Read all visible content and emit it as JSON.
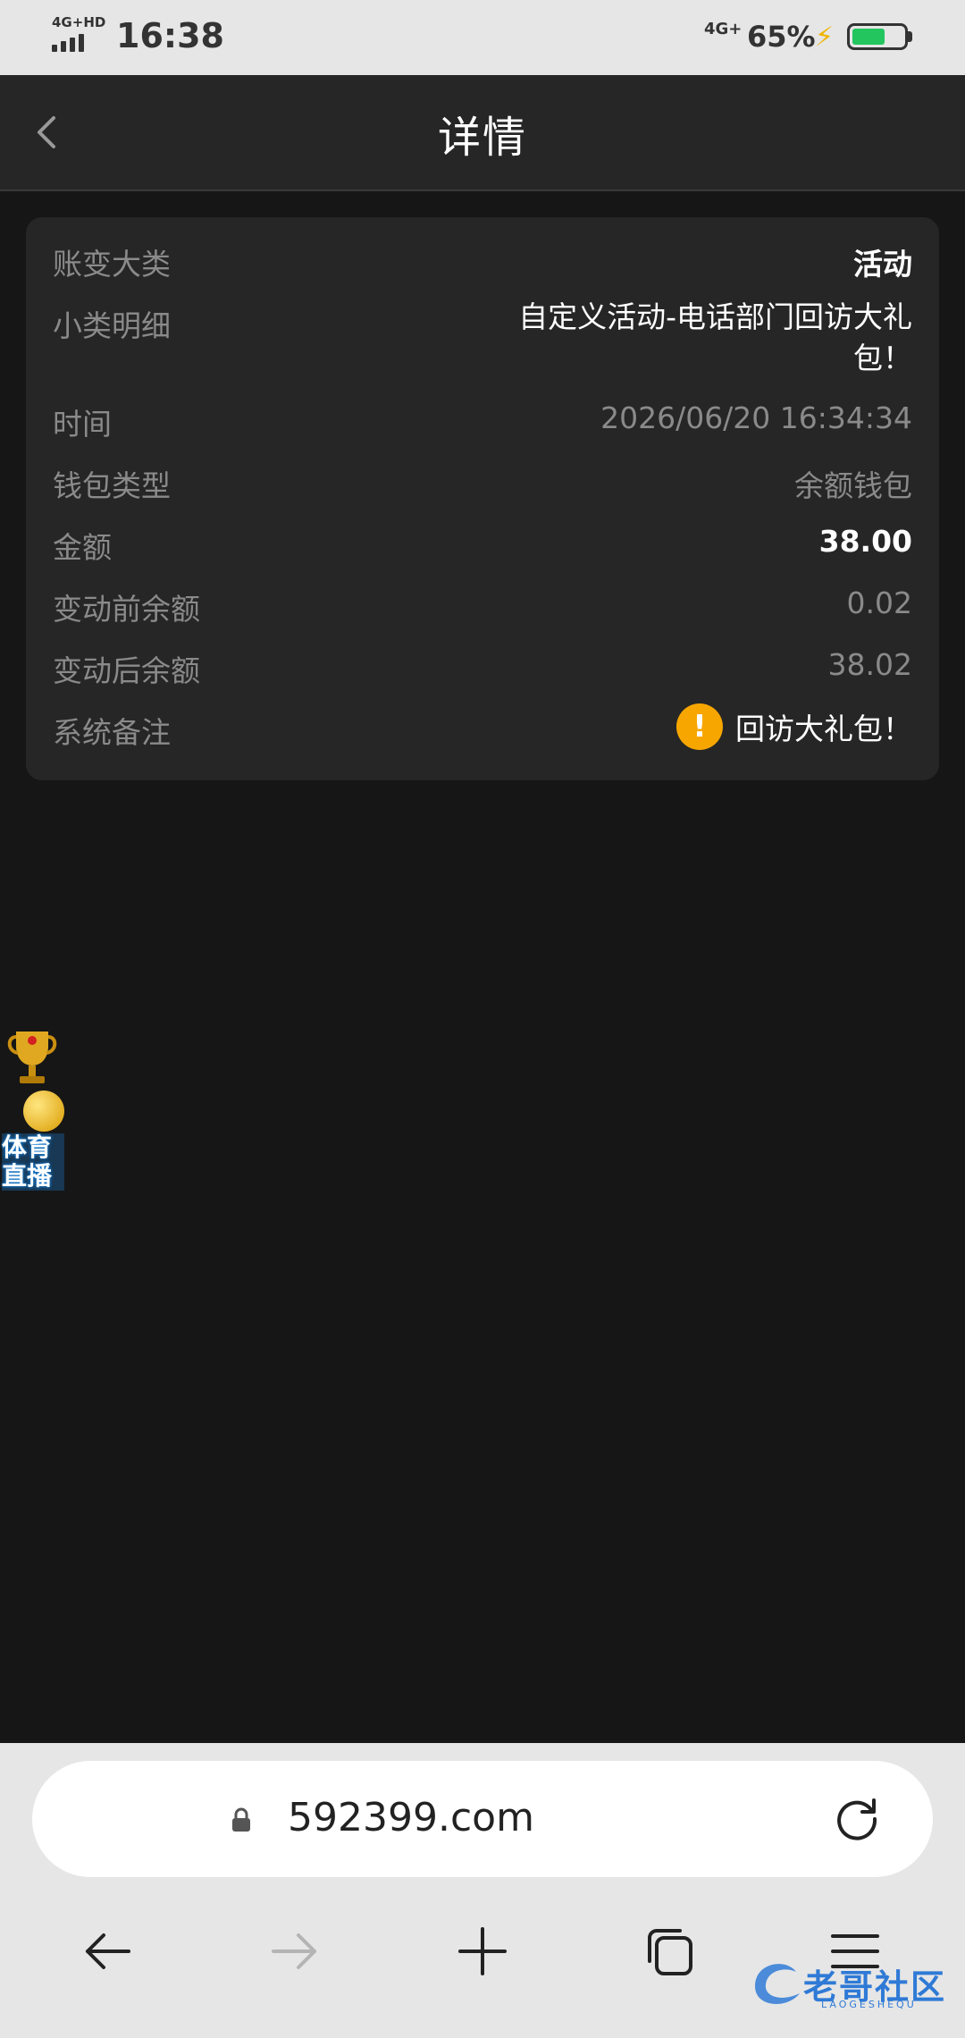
{
  "status_bar": {
    "network_left": "4G+HD",
    "time": "16:38",
    "network_right": "4G+",
    "battery_percent": "65%",
    "battery_level": 0.65,
    "charging": true
  },
  "header": {
    "title": "详情",
    "back_icon": "chevron-left-icon"
  },
  "details": {
    "category_label": "账变大类",
    "category_value": "活动",
    "subcategory_label": "小类明细",
    "subcategory_value": "自定义活动-电话部门回访大礼包！",
    "time_label": "时间",
    "time_value": "2026/06/20 16:34:34",
    "wallet_label": "钱包类型",
    "wallet_value": "余额钱包",
    "amount_label": "金额",
    "amount_value": "38.00",
    "before_label": "变动前余额",
    "before_value": "0.02",
    "after_label": "变动后余额",
    "after_value": "38.02",
    "remark_label": "系统备注",
    "remark_value": "回访大礼包！"
  },
  "floating_badge": {
    "line1": "体育",
    "line2": "直播"
  },
  "browser": {
    "url": "592399.com",
    "icons": [
      "lock-icon",
      "reload-icon",
      "back-arrow-icon",
      "forward-arrow-icon",
      "new-tab-plus-icon",
      "tabs-icon",
      "menu-icon"
    ]
  },
  "watermark": {
    "text": "老哥社区",
    "sub": "LAOGESHEQU"
  },
  "colors": {
    "accent_warning": "#f7a600",
    "background": "#161616",
    "card": "#262626"
  }
}
